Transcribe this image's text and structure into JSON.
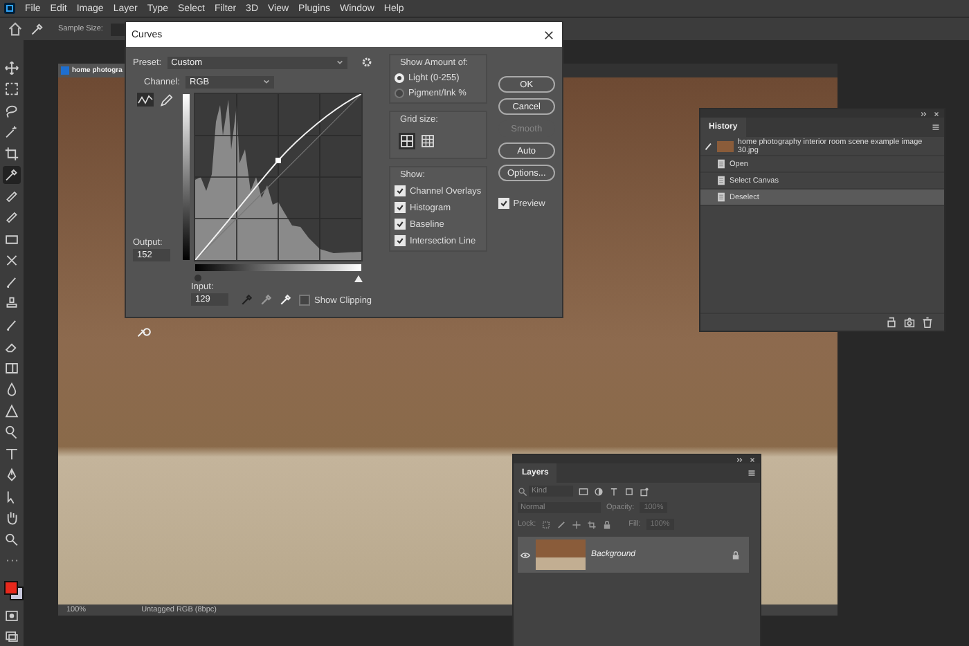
{
  "menu_bar": {
    "items": [
      "File",
      "Edit",
      "Image",
      "Layer",
      "Type",
      "Select",
      "Filter",
      "3D",
      "View",
      "Plugins",
      "Window",
      "Help"
    ]
  },
  "options_bar": {
    "sample_size_label": "Sample Size:"
  },
  "toolbar": {
    "tools": [
      {
        "kind": "move",
        "selected": false
      },
      {
        "kind": "marquee",
        "selected": false
      },
      {
        "kind": "lasso",
        "selected": false
      },
      {
        "kind": "wand",
        "selected": false
      },
      {
        "kind": "crop",
        "selected": false
      },
      {
        "kind": "eyedropper",
        "selected": true
      },
      {
        "kind": "bandage",
        "selected": false
      },
      {
        "kind": "bandage",
        "selected": false
      },
      {
        "kind": "patch",
        "selected": false
      },
      {
        "kind": "cross",
        "selected": false
      },
      {
        "kind": "brush",
        "selected": false
      },
      {
        "kind": "stamp",
        "selected": false
      },
      {
        "kind": "brush",
        "selected": false
      },
      {
        "kind": "eraser",
        "selected": false
      },
      {
        "kind": "gradient",
        "selected": false
      },
      {
        "kind": "drop",
        "selected": false
      },
      {
        "kind": "triangle",
        "selected": false
      },
      {
        "kind": "dodge",
        "selected": false
      },
      {
        "kind": "type",
        "selected": false
      },
      {
        "kind": "pen",
        "selected": false
      },
      {
        "kind": "arrow",
        "selected": false
      },
      {
        "kind": "hand",
        "selected": false
      },
      {
        "kind": "zoom",
        "selected": false
      },
      {
        "kind": "more",
        "selected": false
      }
    ]
  },
  "document": {
    "tab_title": "home photogra",
    "zoom": "100%",
    "status": "Untagged RGB (8bpc)"
  },
  "curves_dialog": {
    "title": "Curves",
    "preset_label": "Preset:",
    "preset": "Custom",
    "channel_label": "Channel:",
    "channel": "RGB",
    "output_label": "Output:",
    "output": "152",
    "input_label": "Input:",
    "input": "129",
    "show_clipping": {
      "label": "Show Clipping",
      "checked": false
    },
    "show_amount": {
      "title": "Show Amount of:",
      "options": [
        {
          "label": "Light  (0-255)",
          "selected": true
        },
        {
          "label": "Pigment/Ink %",
          "selected": false
        }
      ]
    },
    "grid_size": {
      "title": "Grid size:",
      "options": [
        {
          "selected": true
        },
        {
          "selected": false
        }
      ]
    },
    "show": {
      "title": "Show:",
      "options": [
        {
          "label": "Channel Overlays",
          "checked": true
        },
        {
          "label": "Histogram",
          "checked": true
        },
        {
          "label": "Baseline",
          "checked": true
        },
        {
          "label": "Intersection Line",
          "checked": true
        }
      ]
    },
    "buttons": [
      {
        "label": "OK",
        "disabled": false
      },
      {
        "label": "Cancel",
        "disabled": false
      },
      {
        "label": "Smooth",
        "disabled": true
      },
      {
        "label": "Auto",
        "disabled": false
      },
      {
        "label": "Options...",
        "disabled": false
      }
    ],
    "preview": {
      "label": "Preview",
      "checked": true
    }
  },
  "history_panel": {
    "tab": "History",
    "snapshot": "home photography interior room scene example image 30.jpg",
    "items": [
      {
        "label": "Open",
        "selected": false
      },
      {
        "label": "Select Canvas",
        "selected": false
      },
      {
        "label": "Deselect",
        "selected": true
      }
    ]
  },
  "layers_panel": {
    "tab": "Layers",
    "filter": "Kind",
    "blend_mode": "Normal",
    "opacity_label": "Opacity:",
    "opacity": "100%",
    "lock_label": "Lock:",
    "fill_label": "Fill:",
    "fill": "100%",
    "layers": [
      {
        "name": "Background",
        "visible": true,
        "locked": true
      }
    ]
  }
}
